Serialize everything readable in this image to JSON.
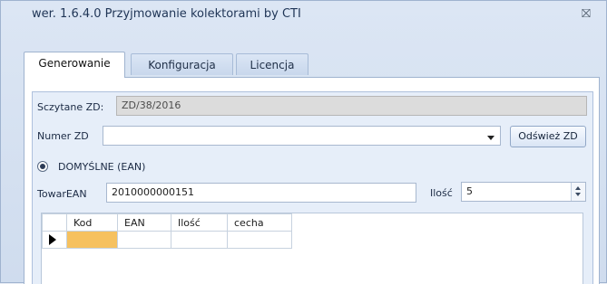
{
  "window": {
    "title": "wer. 1.6.4.0 Przyjmowanie kolektorami by CTI",
    "close_glyph": "⛝"
  },
  "tabs": [
    {
      "label": "Generowanie",
      "active": true
    },
    {
      "label": "Konfiguracja",
      "active": false
    },
    {
      "label": "Licencja",
      "active": false
    }
  ],
  "form": {
    "read_zd_label": "Sczytane ZD:",
    "read_zd_value": "ZD/38/2016",
    "numer_zd_label": "Numer ZD",
    "numer_zd_value": "",
    "refresh_button": "Odśwież ZD",
    "mode_radio_label": "DOMYŚLNE (EAN)",
    "towar_ean_label": "TowarEAN",
    "towar_ean_value": "2010000000151",
    "ilosc_label": "Ilość",
    "ilosc_value": "5"
  },
  "grid": {
    "columns": [
      "Kod",
      "EAN",
      "Ilość",
      "cecha"
    ],
    "rows": [
      {
        "kod": "",
        "ean": "",
        "ilosc": "",
        "cecha": ""
      }
    ]
  },
  "colors": {
    "selected_cell": "#f6c15f",
    "accent": "#1f3556"
  },
  "icons": {
    "close": "close-icon",
    "dropdown": "chevron-down-icon",
    "radio": "radio-selected-icon",
    "row_pointer": "current-row-pointer-icon",
    "spinner": "spin-up-down-icon"
  }
}
